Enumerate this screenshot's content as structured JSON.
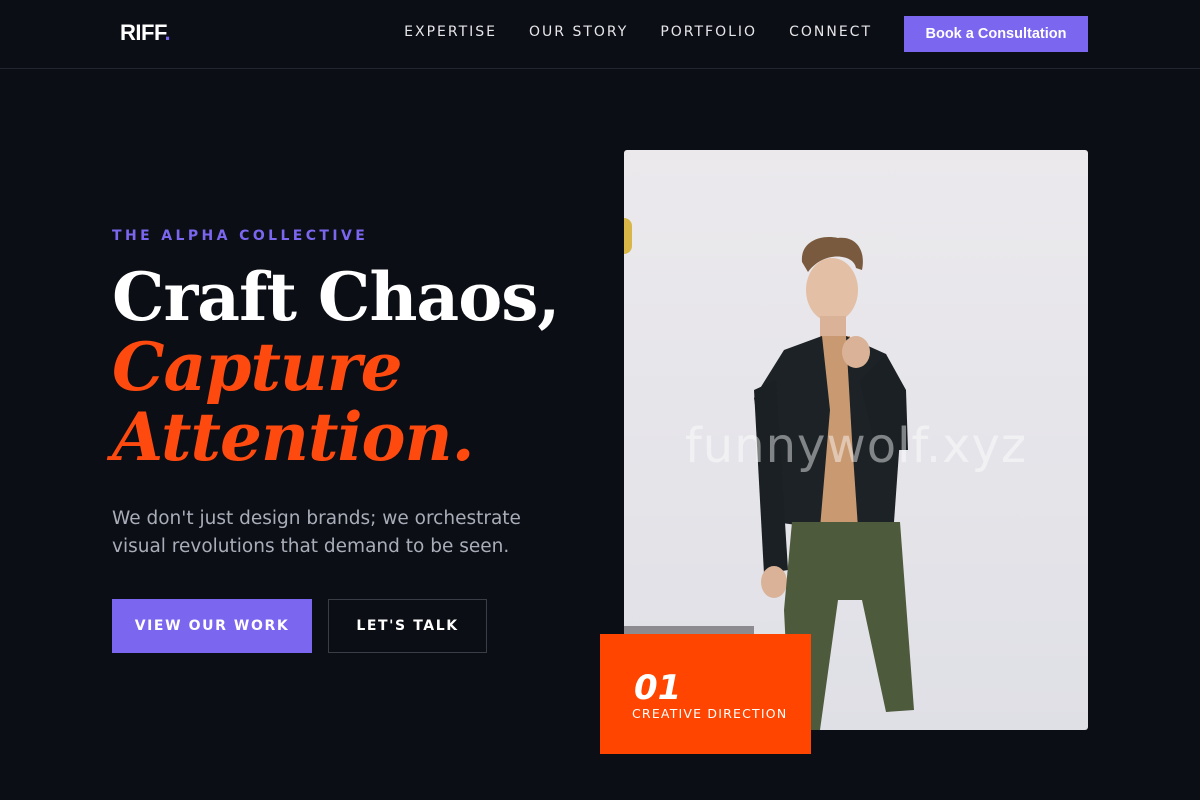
{
  "brand": {
    "name": "RIFF",
    "dot": "."
  },
  "nav": {
    "links": [
      "EXPERTISE",
      "OUR STORY",
      "PORTFOLIO",
      "CONNECT"
    ],
    "cta": "Book a Consultation"
  },
  "hero": {
    "eyebrow": "THE ALPHA COLLECTIVE",
    "headline_line1": "Craft Chaos,",
    "headline_line2": "Capture",
    "headline_line3": "Attention.",
    "lede": "We don't just design brands; we orchestrate visual revolutions that demand to be seen.",
    "primary_button": "VIEW OUR WORK",
    "secondary_button": "LET'S TALK"
  },
  "image": {
    "watermark": "funnywolf.xyz"
  },
  "badge": {
    "number": "01",
    "label": "CREATIVE DIRECTION"
  },
  "colors": {
    "background": "#0b0e15",
    "accent_purple": "#7b66f0",
    "accent_orange": "#ff4500",
    "text_muted": "#a9adb8"
  }
}
